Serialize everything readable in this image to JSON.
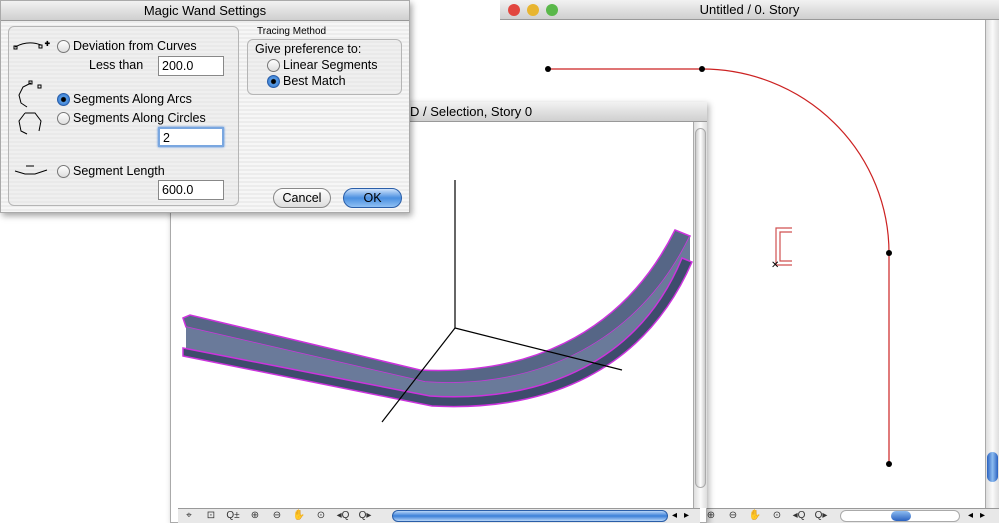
{
  "dialog": {
    "title": "Magic Wand Settings",
    "deviation_label": "Deviation from Curves",
    "less_than_label": "Less than",
    "less_than_value": "200.0",
    "arcs_label": "Segments Along Arcs",
    "circles_label": "Segments Along Circles",
    "circles_value": "2",
    "segment_length_label": "Segment Length",
    "segment_length_value": "600.0",
    "tracing_title": "Tracing Method",
    "preference_label": "Give preference to:",
    "linear_label": "Linear Segments",
    "best_label": "Best Match",
    "selected_mode": "Segments Along Arcs",
    "selected_preference": "Best Match",
    "cancel_label": "Cancel",
    "ok_label": "OK"
  },
  "plan_window": {
    "title": "Untitled / 0. Story"
  },
  "view3d_window": {
    "title": "D / Selection, Story 0"
  },
  "colors": {
    "accent": "#3a7fd8",
    "plan_line": "#cc2222",
    "beam": "#4a5878",
    "beam_edge": "#cc33dd"
  },
  "toolbar_icons": [
    "pointer-icon",
    "zoom-window-icon",
    "zoom-in-out-icon",
    "zoom-in-icon",
    "zoom-out-icon",
    "pan-hand-icon",
    "fit-icon",
    "previous-zoom-icon",
    "next-zoom-icon"
  ]
}
